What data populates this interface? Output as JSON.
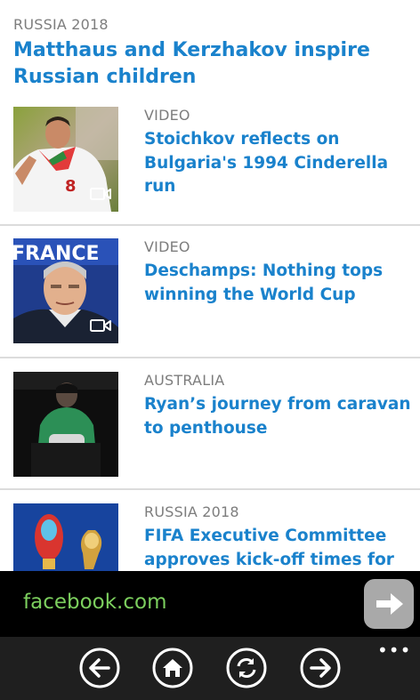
{
  "top_story": {
    "category": "RUSSIA 2018",
    "headline": "Matthaus and Kerzhakov inspire Russian children"
  },
  "stories": [
    {
      "category": "VIDEO",
      "headline": "Stoichkov reflects on Bulgaria's 1994 Cinderella run",
      "has_video": true
    },
    {
      "category": "VIDEO",
      "headline": "Deschamps: Nothing tops winning the World Cup",
      "thumb_text": "FRANCE",
      "has_video": true
    },
    {
      "category": "AUSTRALIA",
      "headline": "Ryan’s journey from caravan to penthouse",
      "has_video": false
    },
    {
      "category": "RUSSIA 2018",
      "headline": "FIFA Executive Committee approves kick-off times for",
      "has_video": false
    }
  ],
  "address_bar": {
    "url": "facebook.com",
    "go_icon": "arrow-right-icon"
  },
  "app_bar": {
    "buttons": [
      "back-icon",
      "home-icon",
      "refresh-icon",
      "forward-icon"
    ],
    "more": "•••"
  },
  "colors": {
    "headline": "#1a82cc",
    "category": "#7d7d7d",
    "url": "#7ccf5e",
    "app_bar_bg": "#1f1f1f"
  }
}
